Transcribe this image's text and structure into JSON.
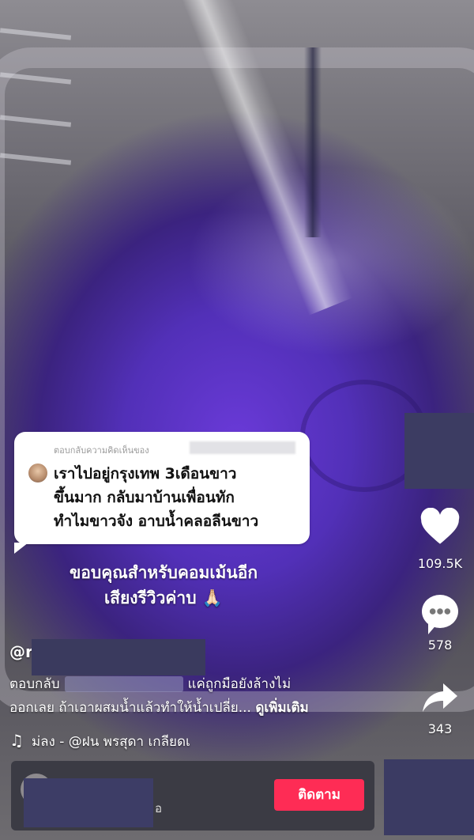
{
  "video": {
    "reply_card": {
      "header": "ตอบกลับความคิดเห็นของ",
      "comment": "เราไปอยู่กรุงเทพ 3เดือนขาว\nขึ้นมาก กลับมาบ้านเพื่อนทัก\nทำไมขาวจัง อาบน้ำคลอลีนขาว"
    },
    "caption_overlay": "ขอบคุณสำหรับคอมเม้นอีก\nเสียงรีวิวค่าบ 🙏🏻"
  },
  "actions": {
    "like": {
      "icon": "heart-icon",
      "count": "109.5K"
    },
    "comment": {
      "icon": "comment-icon",
      "count": "578"
    },
    "share": {
      "icon": "share-icon",
      "count": "343"
    }
  },
  "post": {
    "username": "@r",
    "description_prefix": "ตอบกลับ",
    "description_rest_1": "แค่ถูกมือยังล้างไม่",
    "description_line2": "ออกเลย ถ้าเอาผสมน้ำแล้วทำให้น้ำเปลี่ย...",
    "more_label": "ดูเพิ่มเติม",
    "music": "ม่ลง - @ฝน พรสุดา    เกลียดเ"
  },
  "bottom": {
    "suffix": "อ",
    "follow_label": "ติดตาม"
  },
  "colors": {
    "follow_button": "#fe2c55",
    "water": "#5a34c8"
  }
}
